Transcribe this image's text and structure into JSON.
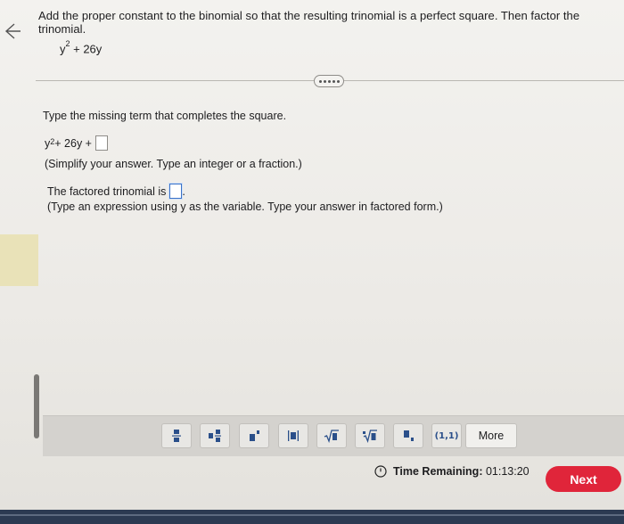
{
  "question": {
    "text": "Add the proper constant to the binomial so that the resulting trinomial is a perfect square. Then factor the trinomial.",
    "expr_base": "y",
    "expr_exp": "2",
    "expr_rest": " + 26y"
  },
  "part1": {
    "instruction": "Type the missing term that completes the square.",
    "expr_base": "y",
    "expr_exp": "2",
    "expr_rest": " + 26y +",
    "answer_value": "",
    "hint": "(Simplify your answer. Type an integer or a fraction.)"
  },
  "part2": {
    "label": "The factored trinomial is",
    "answer_value": "",
    "suffix": ".",
    "hint": "(Type an expression using y as the variable. Type your answer in factored form.)"
  },
  "toolbar": {
    "tools": [
      "fraction-icon",
      "mixed-number-icon",
      "exponent-icon",
      "absolute-value-icon",
      "square-root-icon",
      "nth-root-icon",
      "subscript-icon",
      "ordered-pair-icon"
    ],
    "ordered_pair_label": "(1,1)",
    "more_label": "More"
  },
  "footer": {
    "time_label": "Time Remaining:",
    "time_value": "01:13:20",
    "next_label": "Next"
  },
  "colors": {
    "next_button": "#e0253a",
    "tool_icon": "#2a4f8a",
    "focus_border": "#3a72c7"
  }
}
